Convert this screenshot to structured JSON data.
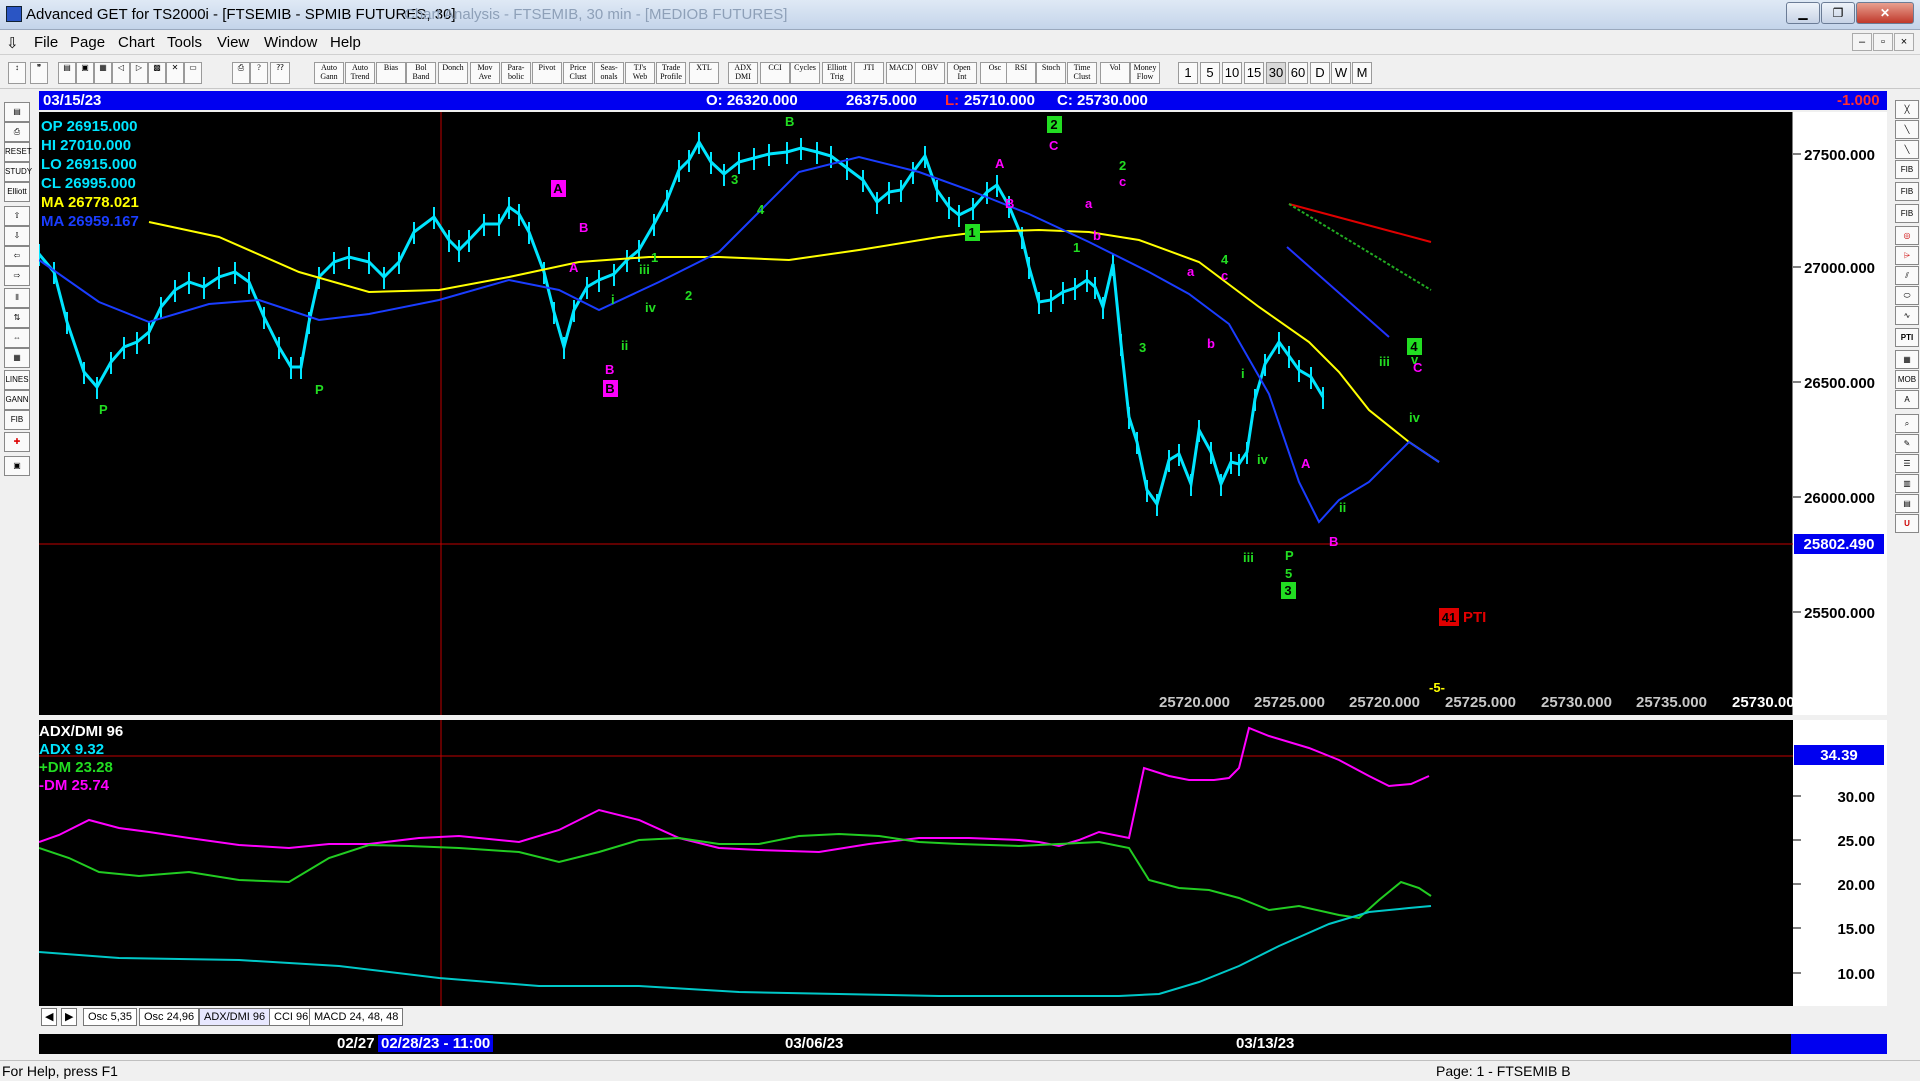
{
  "window": {
    "title": "Advanced GET for TS2000i - [FTSEMIB - SPMIB FUTURES, 30]",
    "faded_title": "Chart Analysis - FTSEMIB, 30 min - [MEDIOB FUTURES]"
  },
  "menu": [
    "File",
    "Page",
    "Chart",
    "Tools",
    "View",
    "Window",
    "Help"
  ],
  "toolbar": {
    "study_buttons": [
      "Auto Gann",
      "Auto Trend",
      "Bias",
      "Bol Band",
      "Donch",
      "Mov Ave",
      "Para-bolic",
      "Pivot",
      "Price Clust",
      "Seas-onals",
      "TJ's Web",
      "Trade Profile",
      "XTL",
      "ADX DMI",
      "CCI",
      "Cycles",
      "Elliott Trig",
      "JTI",
      "MACD",
      "OBV",
      "Open Int",
      "Osc",
      "RSI",
      "Stoch",
      "Time Clust",
      "Vol",
      "Money Flow"
    ],
    "intervals": [
      "1",
      "5",
      "10",
      "15",
      "30",
      "60",
      "D",
      "W",
      "M"
    ],
    "selected_interval": "30"
  },
  "info": {
    "date": "03/15/23",
    "open": "O: 26320.000",
    "high": "26375.000",
    "low_label": "L:",
    "low": "25710.000",
    "close": "C: 25730.000",
    "change": "-1.000"
  },
  "ohlc_panel": {
    "op": "OP  26915.000",
    "hi": "HI   27010.000",
    "lo": "LO  26915.000",
    "cl": "CL  26995.000",
    "ma1": "MA  26778.021",
    "ma2": "MA  26959.167"
  },
  "price_axis": {
    "ticks": [
      "27500.000",
      "27000.000",
      "26500.000",
      "26000.000",
      "25500.000"
    ],
    "current": "25802.490"
  },
  "bottom_prices": [
    "25720.000",
    "25725.000",
    "25720.000",
    "25725.000",
    "25730.000",
    "25735.000",
    "25730.000"
  ],
  "bottom_marker": "-5-",
  "pti": {
    "value": "41",
    "label": "PTI"
  },
  "adx_panel": {
    "title": "ADX/DMI 96",
    "adx": "ADX 9.32",
    "plus_dm": "+DM 23.28",
    "minus_dm": "-DM  25.74",
    "ticks": [
      "30.00",
      "25.00",
      "20.00",
      "15.00",
      "10.00"
    ],
    "current": "34.39"
  },
  "tabs": [
    "Osc 5,35",
    "Osc 24,96",
    "ADX/DMI 96",
    "CCI 96",
    "MACD 24, 48, 48"
  ],
  "dates": {
    "d1": "02/27",
    "cursor": "02/28/23 - 11:00",
    "d2": "03/06/23",
    "d3": "03/13/23"
  },
  "status": {
    "help": "For Help, press F1",
    "page": "Page: 1 - FTSEMIB B"
  },
  "labels": {
    "wave_p1": "P",
    "wave_p2": "P",
    "wave_A1": "A",
    "wave_B1": "B",
    "wave_A2": "A",
    "wave_B2": "B",
    "wave_B2b": "B",
    "wave_i": "i",
    "wave_ii": "ii",
    "wave_iii": "iii",
    "wave_iv": "iv",
    "wave_1": "1",
    "wave_2": "2",
    "wave_3": "3",
    "wave_4": "4",
    "wave_top_B": "B",
    "wave_2box": "2",
    "wave_C": "C",
    "wave_A3": "A",
    "wave_B3": "B",
    "wave_1box": "1",
    "wave_a": "a",
    "wave_b": "b",
    "wave_1b": "1",
    "wave_2b": "2",
    "wave_c": "c",
    "wave_a2": "a",
    "wave_b2": "b",
    "wave_3b": "3",
    "wave_4b": "4",
    "wave_c2": "c",
    "wave_ib": "i",
    "wave_ivb": "iv",
    "wave_iiib": "iii",
    "wave_P5": "P",
    "wave_5": "5",
    "wave_3box": "3",
    "wave_A4": "A",
    "wave_B4": "B",
    "wave_iic": "ii",
    "wave_iiic": "iii",
    "wave_v": "v",
    "wave_ivc": "iv",
    "wave_4box": "4",
    "wave_C2": "C"
  },
  "colors": {
    "price": "#00e5ff",
    "ma_yellow": "#ffff00",
    "ma_blue": "#1a3dff",
    "wave_green": "#22dd22",
    "wave_magenta": "#ff00ff",
    "adx_magenta": "#ff00ff",
    "adx_green": "#22cc22",
    "adx_teal": "#00c8c8"
  }
}
